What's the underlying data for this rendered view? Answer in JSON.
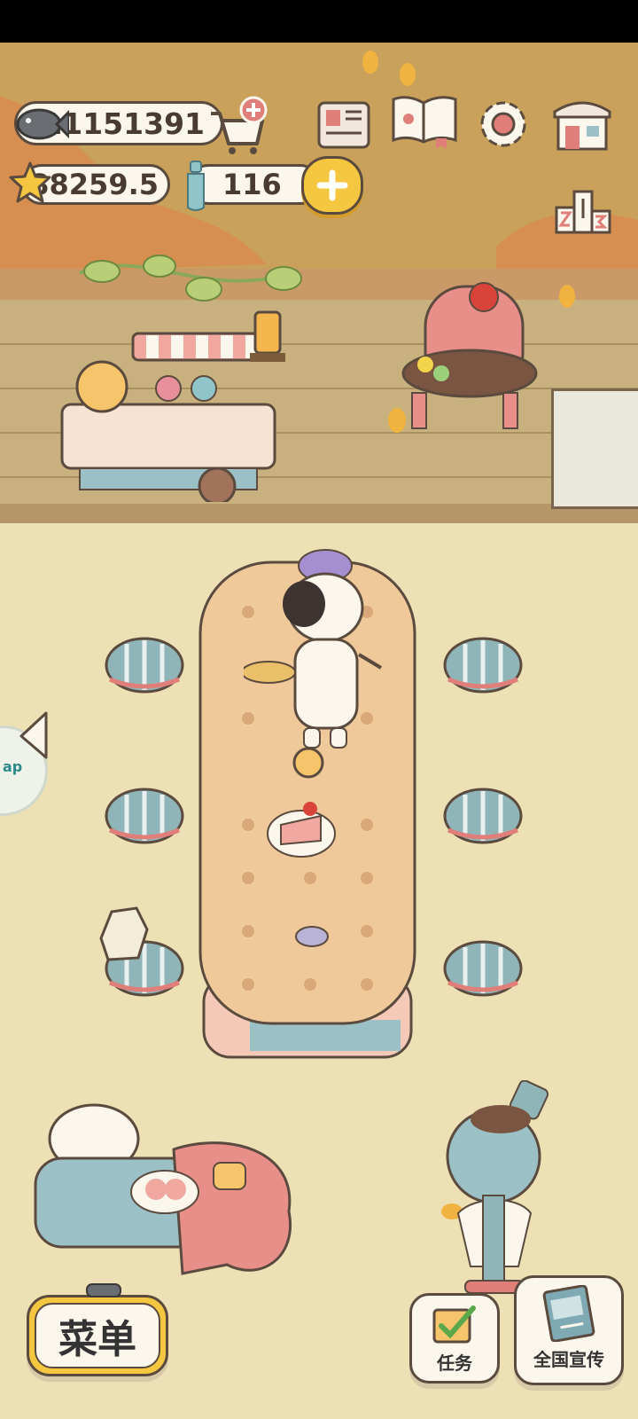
{
  "currency": {
    "fish": "11151391",
    "stars": "88259.5",
    "bottles": "116"
  },
  "side_tab": {
    "text": "ap"
  },
  "bottom_bar": {
    "menu_label": "菜单",
    "tasks_label": "任务",
    "promo_label": "全国宣传"
  },
  "colors": {
    "panel_border": "#5b4a3e",
    "panel_fill": "#fbf7ec",
    "gold": "#f5c640",
    "sky": "#c9a15b",
    "floor": "#ece0b4",
    "deck": "#c8b07f",
    "table": "#f0c99a",
    "stool": "#8fb5b8"
  },
  "icons": [
    "fish-icon",
    "cart-plus-icon",
    "star-icon",
    "bottle-icon",
    "plus-icon",
    "newspaper-icon",
    "book-icon",
    "gear-icon",
    "shop-icon",
    "leaderboard-icon",
    "back-arrow-icon",
    "checklist-icon",
    "flyer-icon"
  ]
}
